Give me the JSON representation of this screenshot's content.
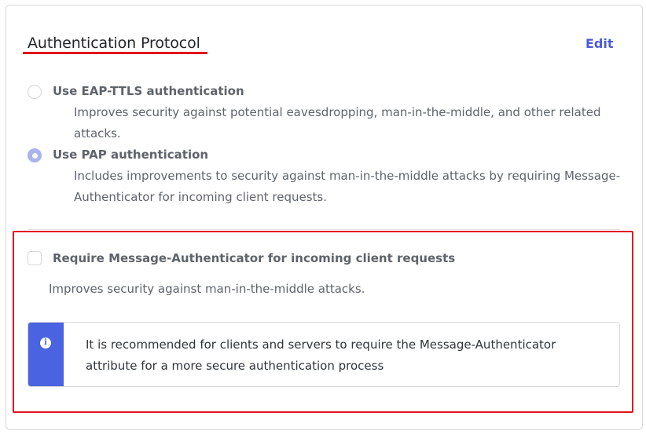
{
  "section": {
    "title": "Authentication Protocol",
    "edit_label": "Edit"
  },
  "options": [
    {
      "label": "Use EAP-TTLS authentication",
      "description": "Improves security against potential eavesdropping, man-in-the-middle, and other related attacks.",
      "selected": false
    },
    {
      "label": "Use PAP authentication",
      "description": "Includes improvements to security against man-in-the-middle attacks by requiring Message-Authenticator for incoming client requests.",
      "selected": true
    }
  ],
  "require_message_auth": {
    "label": "Require Message-Authenticator for incoming client requests",
    "description": "Improves security against man-in-the-middle attacks.",
    "checked": false
  },
  "info_banner": {
    "icon": "info-icon",
    "text": "It is recommended for clients and servers to require the Message-Authenticator attribute for a more secure authentication process"
  },
  "colors": {
    "accent": "#4a63e0",
    "highlight_red": "#e0151f",
    "radio_selected": "#aab4ec"
  }
}
